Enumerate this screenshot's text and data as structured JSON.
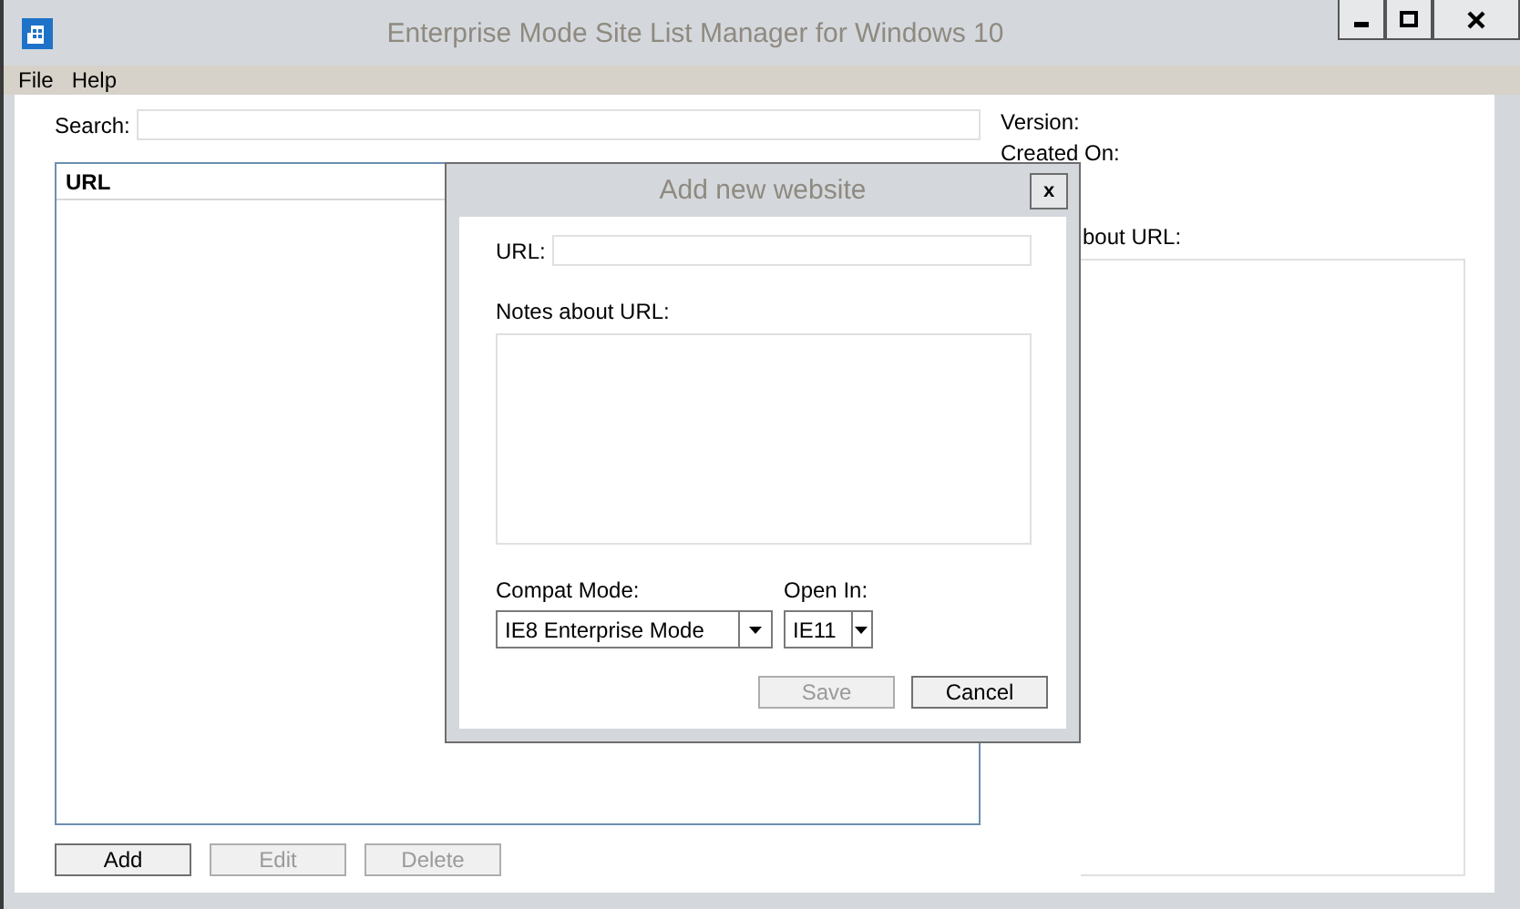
{
  "window": {
    "title": "Enterprise Mode Site List Manager for Windows 10"
  },
  "menu": [
    "File",
    "Help"
  ],
  "search": {
    "label": "Search:"
  },
  "list": {
    "columns": [
      "URL"
    ]
  },
  "details": {
    "version_label": "Version:",
    "created_label": "Created On:",
    "notes_label": "bout URL:"
  },
  "buttons": [
    {
      "label": "Add",
      "disabled": false
    },
    {
      "label": "Edit",
      "disabled": true
    },
    {
      "label": "Delete",
      "disabled": true
    }
  ],
  "dialog": {
    "title": "Add new website",
    "close": "x",
    "url_label": "URL:",
    "notes_label": "Notes about URL:",
    "compat_label": "Compat Mode:",
    "compat_value": "IE8 Enterprise Mode",
    "open_in_label": "Open In:",
    "open_in_value": "IE11",
    "buttons": [
      {
        "label": "Save",
        "disabled": true
      },
      {
        "label": "Cancel",
        "disabled": false
      }
    ]
  }
}
